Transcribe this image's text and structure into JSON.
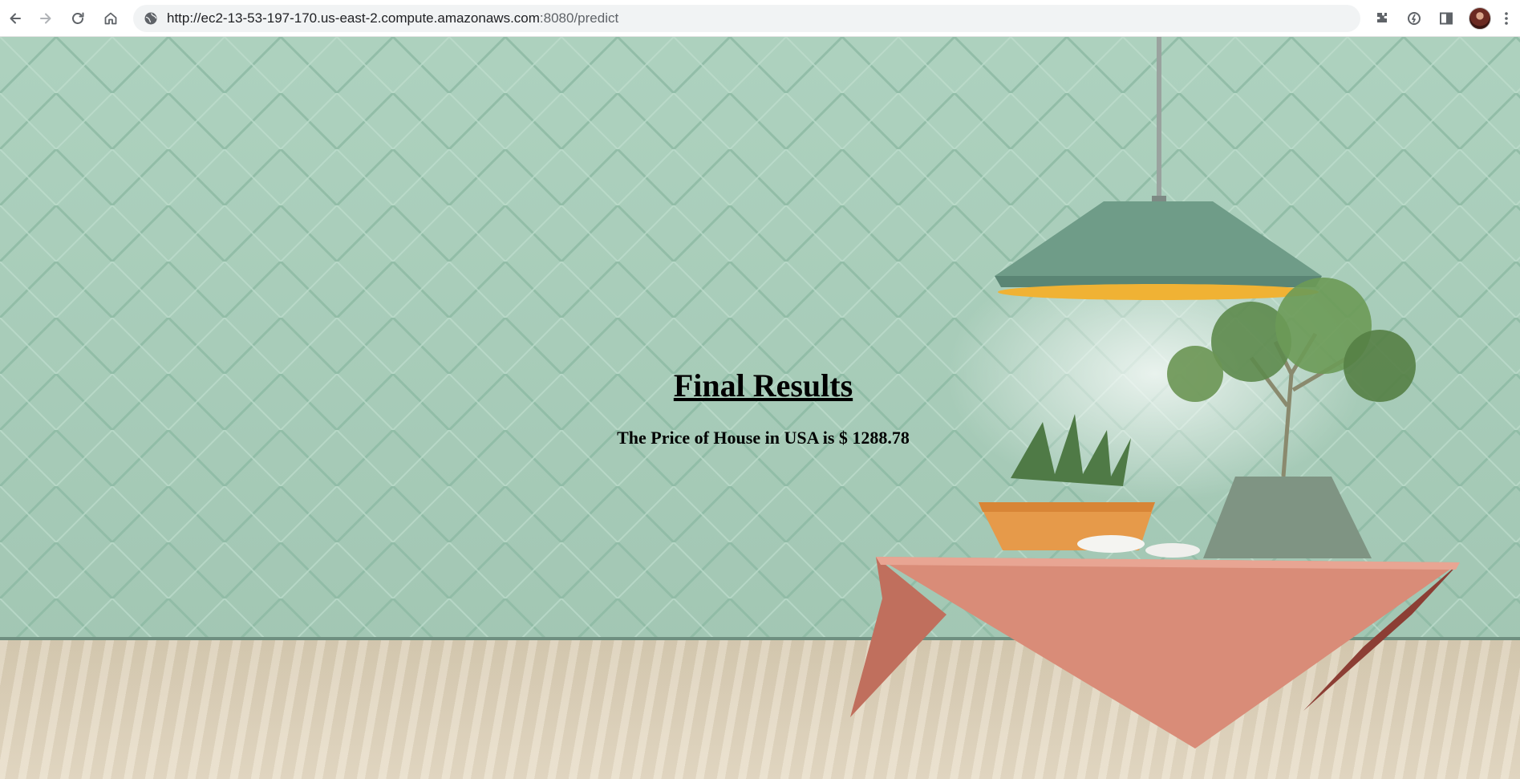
{
  "browser": {
    "url_main": "http://ec2-13-53-197-170.us-east-2.compute.amazonaws.com",
    "url_tail": ":8080/predict"
  },
  "page": {
    "heading": "Final Results",
    "result_text": "The Price of House in USA is $ 1288.78"
  },
  "colors": {
    "wall": "#a9cfbb",
    "floor": "#e0d4bd",
    "table": "#d98c78",
    "lamp": "#6f9c88",
    "pot": "#e69a4a"
  },
  "icons": {
    "back": "arrow-left-icon",
    "forward": "arrow-right-icon",
    "reload": "reload-icon",
    "home": "home-icon",
    "site_info": "site-info-icon",
    "extensions": "puzzle-icon",
    "performance": "speed-icon",
    "side_panel": "side-panel-icon",
    "menu": "kebab-menu-icon"
  }
}
